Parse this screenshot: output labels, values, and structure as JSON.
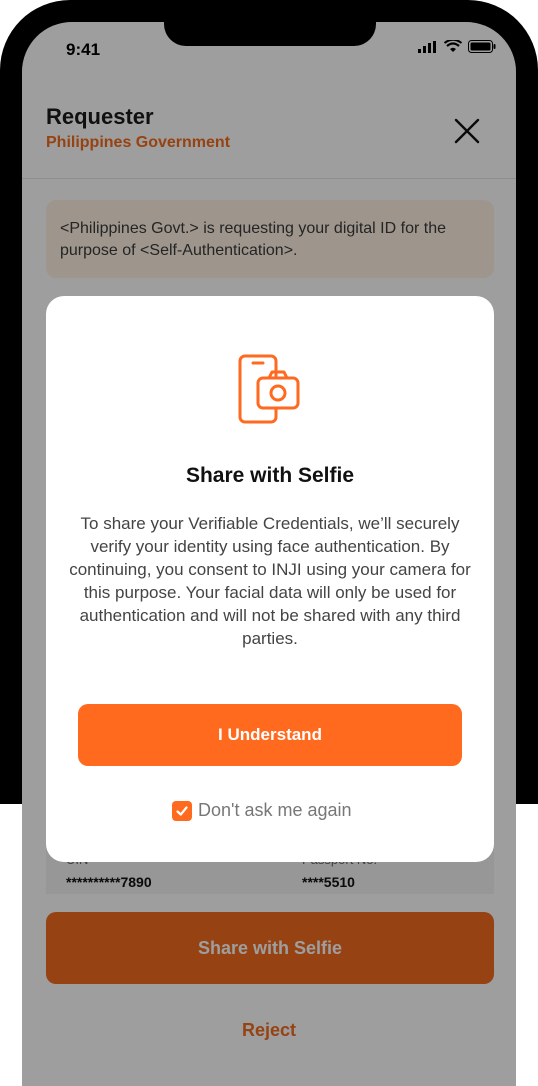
{
  "status_bar": {
    "time": "9:41"
  },
  "header": {
    "title": "Requester",
    "subtitle": "Philippines Government"
  },
  "banner": {
    "text": "<Philippines Govt.> is requesting your digital ID for the purpose of <Self-Authentication>."
  },
  "fields": [
    {
      "label": "UIN",
      "value": "**********7890"
    },
    {
      "label": "Passport No.",
      "value": "****5510"
    }
  ],
  "actions": {
    "share_label": "Share with Selfie",
    "reject_label": "Reject"
  },
  "modal": {
    "title": "Share with Selfie",
    "body": "To share your Verifiable Credentials, we’ll securely verify your identity using face authentication. By continuing, you consent to INJI using your camera for this purpose. Your facial data will only be used for authentication and will not be shared with any third parties.",
    "button_label": "I Understand",
    "checkbox_label": "Don't ask me again",
    "checkbox_checked": true
  },
  "colors": {
    "accent": "#f26b1d",
    "button": "#ff6a1f",
    "banner_bg": "#fff3e4"
  },
  "icons": [
    "signal-icon",
    "wifi-icon",
    "battery-icon",
    "close-icon",
    "phone-camera-icon",
    "checkmark-icon"
  ]
}
